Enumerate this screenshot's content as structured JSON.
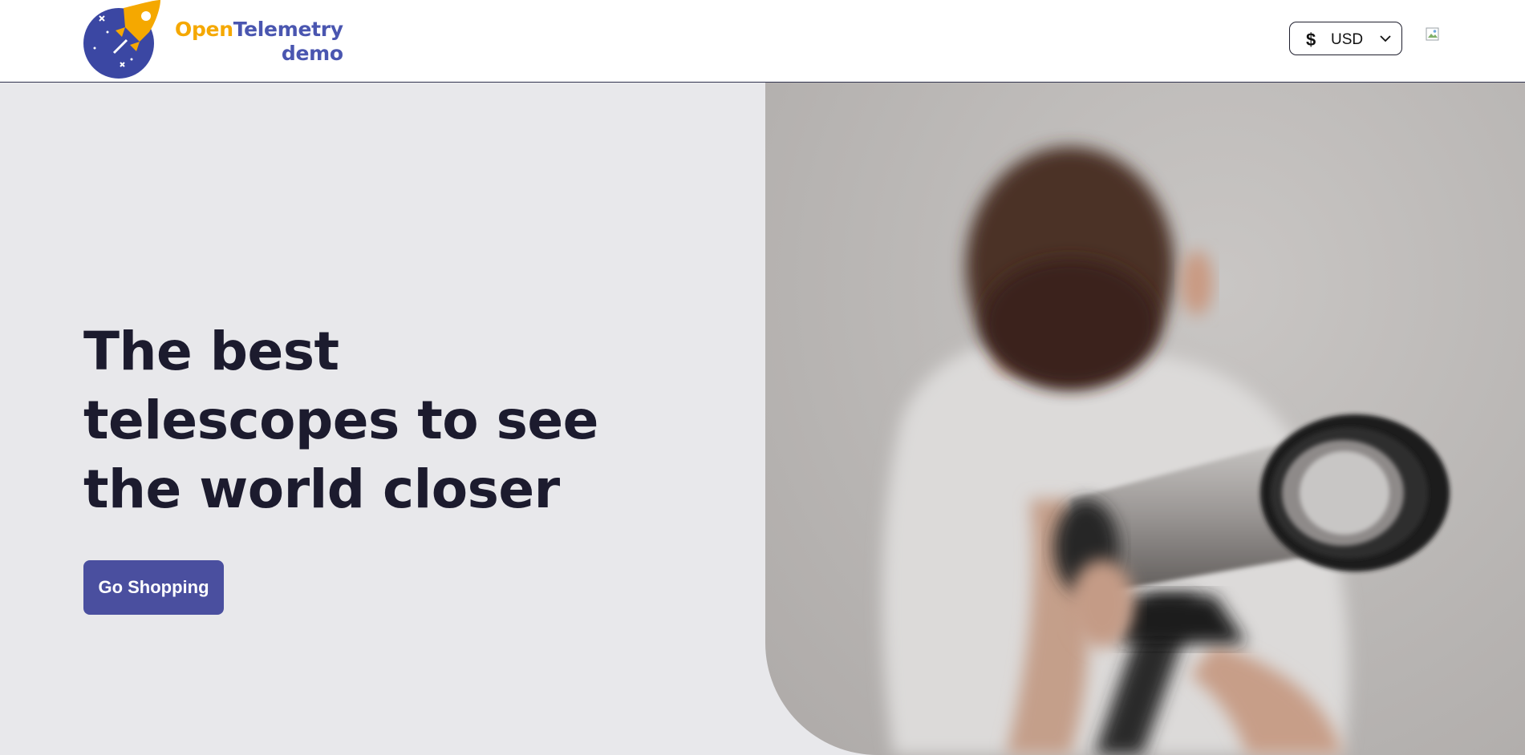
{
  "header": {
    "logo": {
      "word_open": "Open",
      "word_telemetry": "Telemetry",
      "word_demo": "demo"
    },
    "currency": {
      "symbol": "$",
      "code": "USD"
    },
    "cart_icon": "broken-image-icon"
  },
  "hero": {
    "title": "The best telescopes to see the world closer",
    "button_label": "Go Shopping",
    "image_alt": "boy-looking-through-telescope"
  },
  "colors": {
    "brand_orange": "#f5a800",
    "brand_blue": "#4a56b0",
    "button_bg": "#4a4f9f",
    "hero_bg": "#e8e8eb",
    "title_color": "#1c1b2e"
  }
}
